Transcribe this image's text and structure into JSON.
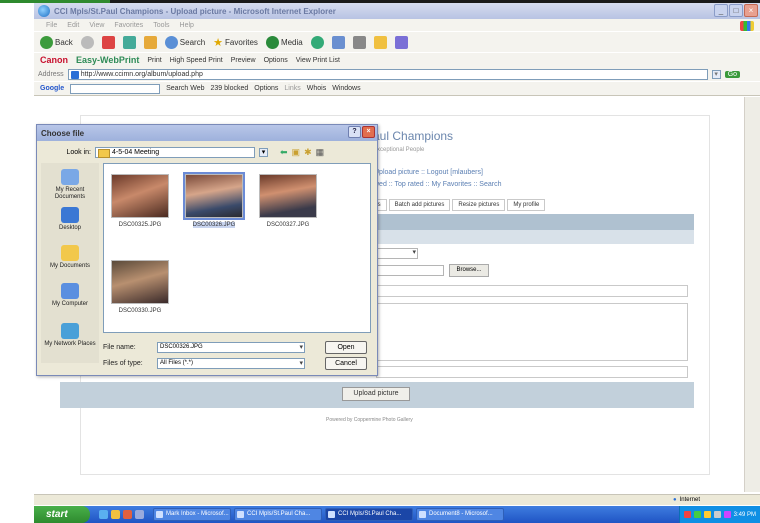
{
  "browser": {
    "title": "CCI Mpls/St.Paul Champions - Upload picture - Microsoft Internet Explorer",
    "menu": [
      "File",
      "Edit",
      "View",
      "Favorites",
      "Tools",
      "Help"
    ],
    "toolbar": {
      "back": "Back",
      "search": "Search",
      "favorites": "Favorites",
      "media": "Media"
    },
    "canon_bar": {
      "brand": "Canon",
      "product": "Easy-WebPrint",
      "print": "Print",
      "high_speed": "High Speed Print",
      "preview": "Preview",
      "options": "Options",
      "view_print_list": "View Print List"
    },
    "address": {
      "label": "Address",
      "url": "http://www.ccimn.org/album/upload.php",
      "go": "Go"
    },
    "google": {
      "label": "Google",
      "search_web": "Search Web",
      "blocked": "239 blocked",
      "options": "Options",
      "links": "Links",
      "whois": "Whois",
      "windows": "Windows"
    },
    "status": {
      "zone": "Internet"
    }
  },
  "page": {
    "site_title": "aul Champions",
    "site_subtitle": "Exceptional People",
    "nav_line1": "Upload picture :: Logout [mlaubers]",
    "nav_line2": "wed :: Top rated :: My Favorites :: Search",
    "tabs": [
      "ts",
      "Batch add pictures",
      "Resize pictures",
      "My profile"
    ],
    "browse": "Browse...",
    "upload_button": "Upload picture",
    "powered_by": "Powered by Coppermine Photo Gallery"
  },
  "dialog": {
    "title": "Choose file",
    "look_in_label": "Look in:",
    "look_in_value": "4-5-04 Meeting",
    "places": [
      "My Recent Documents",
      "Desktop",
      "My Documents",
      "My Computer",
      "My Network Places"
    ],
    "files": [
      "DSC00325.JPG",
      "DSC00326.JPG",
      "DSC00327.JPG",
      "DSC00330.JPG"
    ],
    "selected_file": "DSC00326.JPG",
    "file_name_label": "File name:",
    "file_name_value": "DSC00326.JPG",
    "file_type_label": "Files of type:",
    "file_type_value": "All Files (*.*)",
    "open": "Open",
    "cancel": "Cancel"
  },
  "taskbar": {
    "start": "start",
    "tasks": [
      "Mark Inbox - Microsof...",
      "CCI Mpls/St.Paul Cha...",
      "CCI Mpls/St.Paul Cha...",
      "Document8 - Microsof..."
    ],
    "active_index": 2,
    "clock": "3:49 PM"
  }
}
